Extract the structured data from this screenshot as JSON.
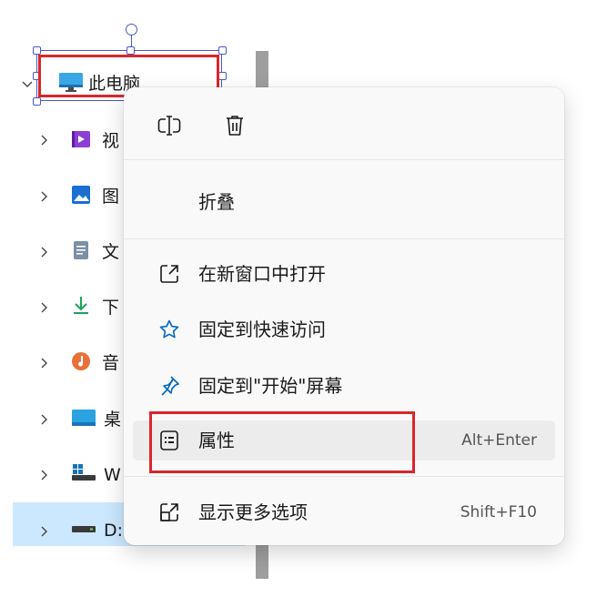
{
  "tree": {
    "items": [
      {
        "label": "此电脑",
        "icon": "monitor-icon",
        "expanded": true
      },
      {
        "label": "视",
        "icon": "videos-folder-icon"
      },
      {
        "label": "图",
        "icon": "pictures-folder-icon"
      },
      {
        "label": "文",
        "icon": "documents-folder-icon"
      },
      {
        "label": "下",
        "icon": "downloads-icon"
      },
      {
        "label": "音",
        "icon": "music-icon"
      },
      {
        "label": "桌",
        "icon": "desktop-folder-icon"
      },
      {
        "label": "W",
        "icon": "windows-drive-icon"
      },
      {
        "label": "D:",
        "icon": "drive-icon",
        "selected": true
      }
    ]
  },
  "menu": {
    "top_actions": [
      {
        "name": "rename",
        "icon": "rename-icon"
      },
      {
        "name": "delete",
        "icon": "trash-icon"
      }
    ],
    "collapse_label": "折叠",
    "items": [
      {
        "label": "在新窗口中打开",
        "icon": "open-new-window-icon"
      },
      {
        "label": "固定到快速访问",
        "icon": "star-icon"
      },
      {
        "label": "固定到\"开始\"屏幕",
        "icon": "pin-icon"
      },
      {
        "label": "属性",
        "icon": "properties-icon",
        "shortcut": "Alt+Enter"
      },
      {
        "label": "显示更多选项",
        "icon": "more-options-icon",
        "shortcut": "Shift+F10"
      }
    ]
  },
  "colors": {
    "accent": "#0067c0",
    "selection": "#cce8ff",
    "highlight_box": "#d9262b",
    "handle": "#4b57c8"
  }
}
